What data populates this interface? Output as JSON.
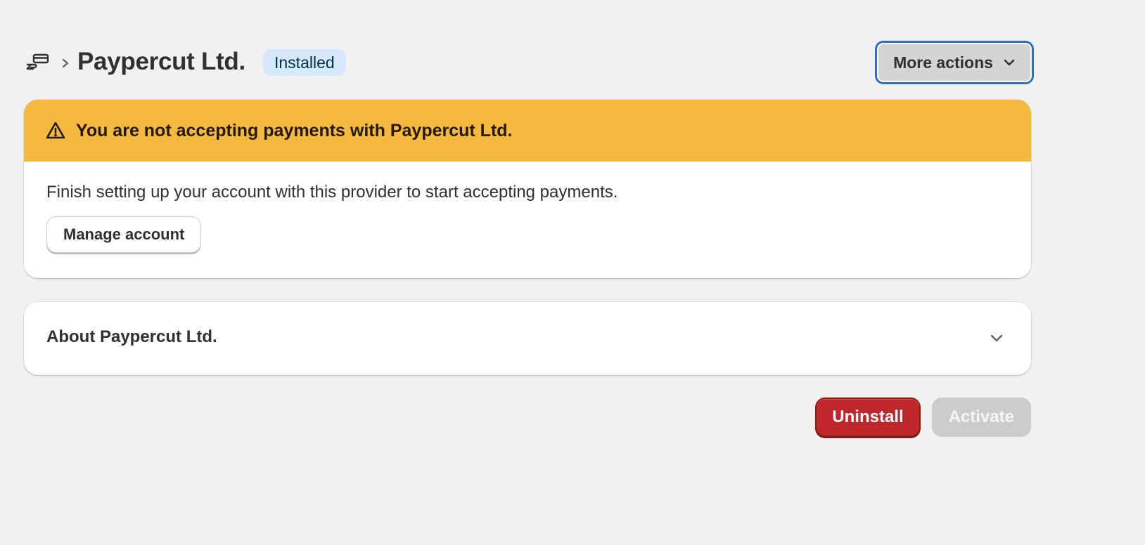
{
  "header": {
    "breadcrumb_icon": "payments-hand-icon",
    "title": "Paypercut Ltd.",
    "badge": "Installed",
    "more_actions_label": "More actions"
  },
  "warning_card": {
    "banner_icon": "alert-triangle-icon",
    "banner_title": "You are not accepting payments with Paypercut Ltd.",
    "body_text": "Finish setting up your account with this provider to start accepting payments.",
    "manage_button_label": "Manage account"
  },
  "about_card": {
    "title": "About Paypercut Ltd.",
    "toggle_icon": "chevron-down-icon"
  },
  "footer": {
    "uninstall_label": "Uninstall",
    "activate_label": "Activate"
  },
  "colors": {
    "background": "#f1f1f1",
    "banner_warning": "#f5b940",
    "badge_info": "#d6e8fb",
    "critical": "#c0272d",
    "focus_ring": "#2c6ecb",
    "disabled": "#cccccc"
  }
}
